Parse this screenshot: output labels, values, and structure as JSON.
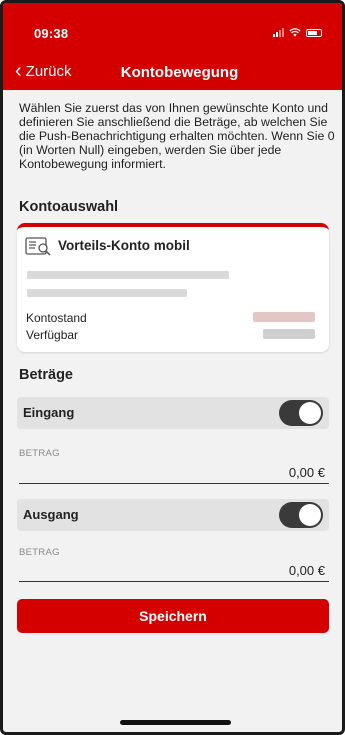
{
  "status_bar": {
    "time": "09:38"
  },
  "header": {
    "back_label": "Zurück",
    "title": "Kontobewegung"
  },
  "intro_text": "Wählen Sie zuerst das von Ihnen gewünschte Konto und definieren Sie anschließend die Beträge, ab welchen Sie die Push-Benachrichtigung erhalten möchten. Wenn Sie 0 (in Worten Null) eingeben, werden Sie über jede Kontobewegung informiert.",
  "account_section": {
    "title": "Kontoauswahl",
    "card": {
      "icon": "account-card-icon",
      "name": "Vorteils-Konto mobil",
      "balance_label": "Kontostand",
      "available_label": "Verfügbar"
    }
  },
  "amounts_section": {
    "title": "Beträge",
    "incoming": {
      "label": "Eingang",
      "enabled": true,
      "field_label": "BETRAG",
      "value": "0,00 €"
    },
    "outgoing": {
      "label": "Ausgang",
      "enabled": true,
      "field_label": "BETRAG",
      "value": "0,00 €"
    }
  },
  "save_button": {
    "label": "Speichern"
  },
  "colors": {
    "brand_red": "#d40000",
    "toggle_on": "#3a3a3a",
    "background": "#f2f2f2"
  }
}
